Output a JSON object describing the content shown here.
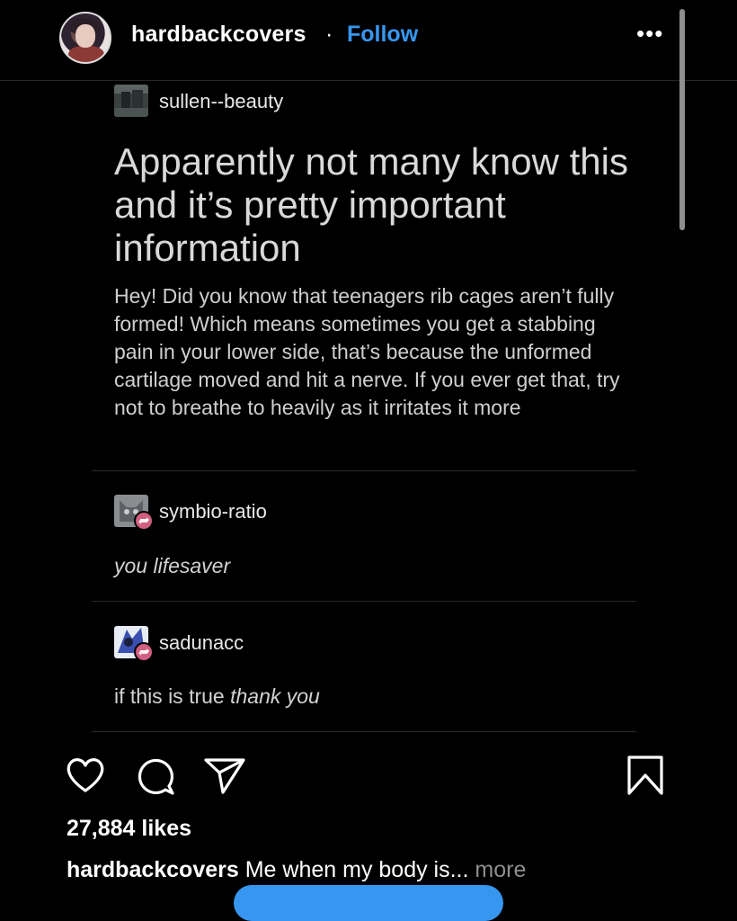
{
  "header": {
    "username": "hardbackcovers",
    "separator": "·",
    "follow_label": "Follow",
    "more_label": "•••"
  },
  "post": {
    "original_blog": "sullen--beauty",
    "title": "Apparently not many know this and it’s pretty important information",
    "body": "Hey! Did you know that teenagers rib cages aren’t fully formed! Which means sometimes you get a stabbing pain in your lower side, that’s because the unformed cartilage moved and hit a nerve. If you ever get that, try not to breathe to heavily as it irritates it more",
    "replies": [
      {
        "blog": "symbio-ratio",
        "text_plain": "",
        "text_italic": "you lifesaver"
      },
      {
        "blog": "sadunacc",
        "text_plain": "if this is true ",
        "text_italic": "thank you"
      }
    ],
    "reblog_badge_icon": "reblog-icon"
  },
  "actions": {
    "like_icon": "heart-icon",
    "comment_icon": "comment-icon",
    "share_icon": "send-icon",
    "save_icon": "bookmark-icon"
  },
  "likes": "27,884 likes",
  "caption": {
    "username": "hardbackcovers",
    "text": " Me when my body is... ",
    "more_label": "more"
  },
  "colors": {
    "background": "#000000",
    "accent": "#3797f0",
    "reblog_badge": "#d05f82",
    "muted": "#8e8e8e"
  }
}
